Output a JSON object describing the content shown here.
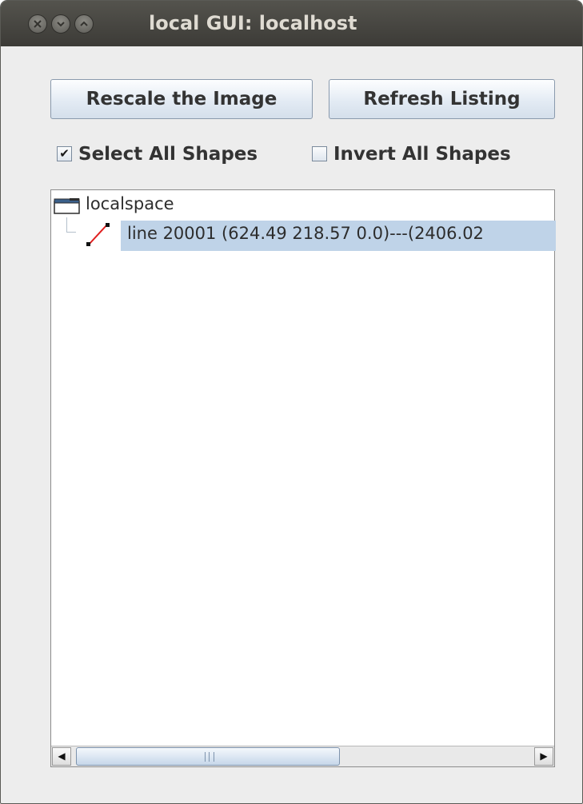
{
  "window": {
    "title": "local GUI: localhost",
    "controls": [
      "close",
      "minimize",
      "maximize"
    ]
  },
  "buttons": {
    "rescale_label": "Rescale the Image",
    "refresh_label": "Refresh Listing"
  },
  "checkboxes": {
    "select_all": {
      "label": "Select All Shapes",
      "checked": true,
      "mark": "✔"
    },
    "invert_all": {
      "label": "Invert All Shapes",
      "checked": false,
      "mark": ""
    }
  },
  "tree": {
    "root": {
      "label": "localspace",
      "icon": "folder-icon"
    },
    "children": [
      {
        "label": "line 20001 (624.49 218.57 0.0)---(2406.02",
        "icon": "line-shape-icon",
        "selected": true
      }
    ]
  },
  "scrollbar": {
    "left_arrow": "◀",
    "right_arrow": "▶"
  },
  "colors": {
    "titlebar": "#3c3b37",
    "selection": "#bfd3e8",
    "line_shape": "#e02020"
  }
}
